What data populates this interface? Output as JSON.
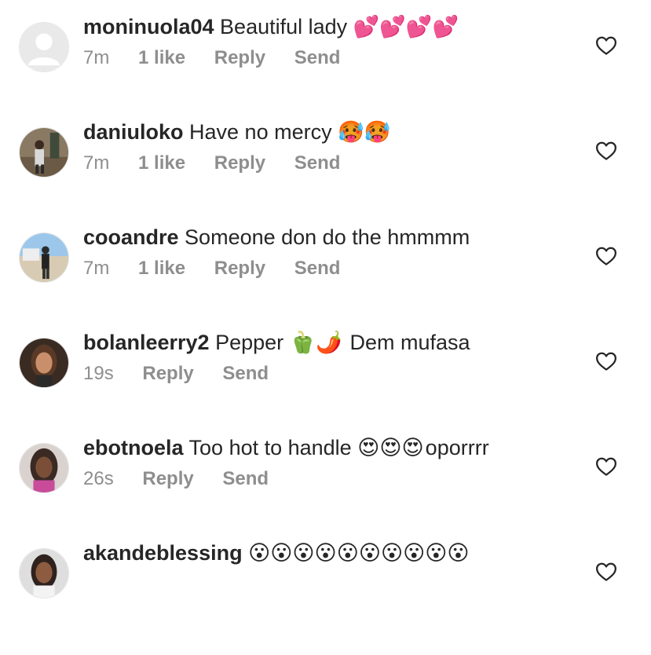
{
  "comments": [
    {
      "username": "moninuola04",
      "text": "Beautiful lady",
      "emoji": "💕💕💕💕",
      "time": "7m",
      "likes": "1 like",
      "reply_label": "Reply",
      "send_label": "Send",
      "avatar": "default-avatar-icon"
    },
    {
      "username": "daniuloko",
      "text": "Have no mercy",
      "emoji": "🥵🥵",
      "time": "7m",
      "likes": "1 like",
      "reply_label": "Reply",
      "send_label": "Send",
      "avatar": "profile-photo"
    },
    {
      "username": "cooandre",
      "text": "Someone don do the hmmmm",
      "emoji": "",
      "time": "7m",
      "likes": "1 like",
      "reply_label": "Reply",
      "send_label": "Send",
      "avatar": "profile-photo"
    },
    {
      "username": "bolanleerry2",
      "text": "Pepper",
      "emoji": "🫑🌶️",
      "trail": "Dem mufasa",
      "time": "19s",
      "reply_label": "Reply",
      "send_label": "Send",
      "avatar": "profile-photo"
    },
    {
      "username": "ebotnoela",
      "text": "Too hot to handle",
      "emoji": "😍😍😍",
      "trail": "oporrrr",
      "time": "26s",
      "reply_label": "Reply",
      "send_label": "Send",
      "avatar": "profile-photo"
    },
    {
      "username": "akandeblessing",
      "text": "",
      "emoji": "😮😮😮😮😮😮😮😮😮😮",
      "avatar": "profile-photo"
    }
  ],
  "icons": {
    "like": "heart-outline-icon"
  },
  "colors": {
    "text": "#262626",
    "meta": "#8e8e8e"
  }
}
